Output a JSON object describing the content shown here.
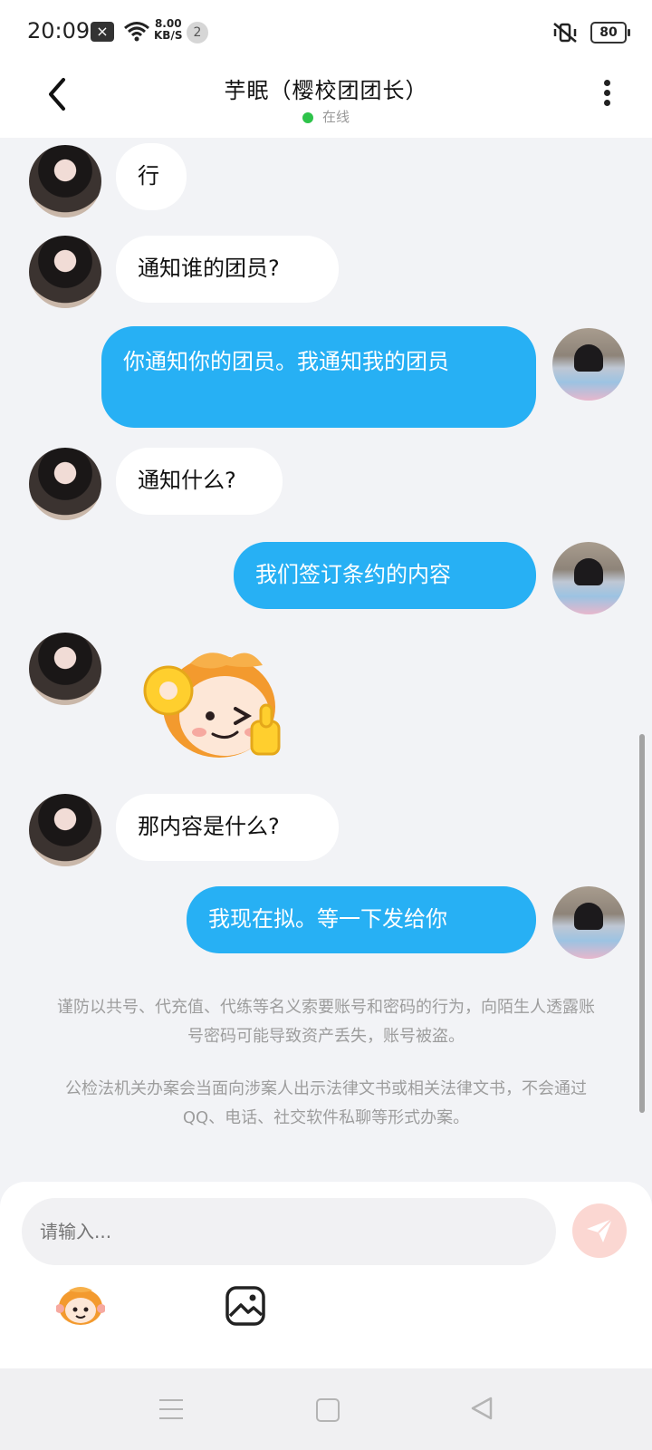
{
  "status_bar": {
    "time": "20:09",
    "speed_value": "8.00",
    "speed_unit": "KB/S",
    "notification_count": "2",
    "battery": "80"
  },
  "header": {
    "title": "芋眠（樱校团团长）",
    "status": "在线"
  },
  "messages": [
    {
      "side": "in",
      "text": "行"
    },
    {
      "side": "in",
      "text": "通知谁的团员?"
    },
    {
      "side": "out",
      "text": "你通知你的团员。我通知我的团员"
    },
    {
      "side": "in",
      "text": "通知什么?"
    },
    {
      "side": "out",
      "text": "我们签订条约的内容"
    },
    {
      "side": "in",
      "type": "sticker",
      "sticker": "monkey-ok-sticker"
    },
    {
      "side": "in",
      "text": "那内容是什么?"
    },
    {
      "side": "out",
      "text": "我现在拟。等一下发给你"
    }
  ],
  "notices": [
    "谨防以共号、代充值、代练等名义索要账号和密码的行为，向陌生人透露账号密码可能导致资产丢失，账号被盗。",
    "公检法机关办案会当面向涉案人出示法律文书或相关法律文书，不会通过QQ、电话、社交软件私聊等形式办案。"
  ],
  "input": {
    "placeholder": "请输入..."
  },
  "colors": {
    "outgoing_bubble": "#27b0f4",
    "incoming_bubble": "#ffffff",
    "online": "#2ec34a",
    "send_button": "#fbd7d2"
  }
}
